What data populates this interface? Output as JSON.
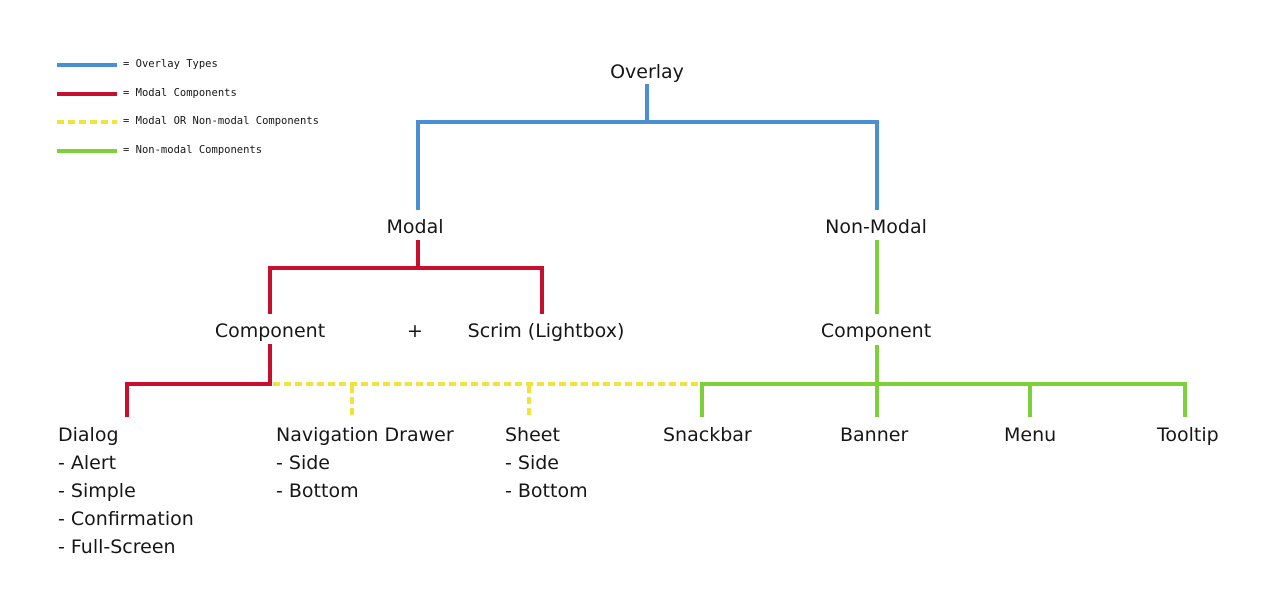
{
  "colors": {
    "overlay_types": "#4a8fd6",
    "modal": "#c8102e",
    "modal_or_nonmodal": "#f2e33a",
    "non_modal": "#7ed03a"
  },
  "legend": [
    {
      "key": "overlay_types",
      "style": "solid",
      "label": "= Overlay Types"
    },
    {
      "key": "modal",
      "style": "solid",
      "label": "= Modal Components"
    },
    {
      "key": "modal_or_nonmodal",
      "style": "dashed",
      "label": "= Modal OR Non-modal Components"
    },
    {
      "key": "non_modal",
      "style": "solid",
      "label": "= Non-modal Components"
    }
  ],
  "tree": {
    "root": "Overlay",
    "modal": "Modal",
    "non_modal": "Non-Modal",
    "modal_component": "Component",
    "plus": "+",
    "scrim": "Scrim (Lightbox)",
    "non_modal_component": "Component"
  },
  "leaves": {
    "dialog": {
      "title": "Dialog",
      "items": [
        "- Alert",
        "- Simple",
        "- Confirmation",
        "- Full-Screen"
      ]
    },
    "navigation_drawer": {
      "title": "Navigation Drawer",
      "items": [
        "- Side",
        "- Bottom"
      ]
    },
    "sheet": {
      "title": "Sheet",
      "items": [
        "- Side",
        "- Bottom"
      ]
    },
    "snackbar": {
      "title": "Snackbar"
    },
    "banner": {
      "title": "Banner"
    },
    "menu": {
      "title": "Menu"
    },
    "tooltip": {
      "title": "Tooltip"
    }
  }
}
